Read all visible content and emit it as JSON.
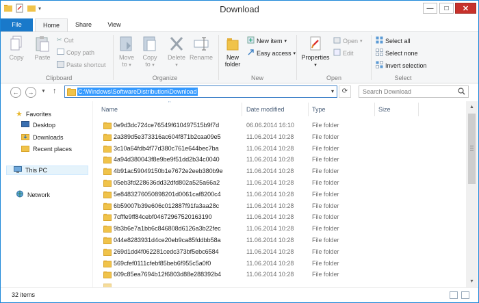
{
  "window": {
    "title": "Download"
  },
  "ribbon": {
    "tabs": {
      "file": "File",
      "home": "Home",
      "share": "Share",
      "view": "View"
    },
    "clipboard": {
      "copy": "Copy",
      "paste": "Paste",
      "cut": "Cut",
      "copy_path": "Copy path",
      "paste_shortcut": "Paste shortcut",
      "label": "Clipboard"
    },
    "organize": {
      "move_to_1": "Move",
      "move_to_2": "to",
      "copy_to_1": "Copy",
      "copy_to_2": "to",
      "delete": "Delete",
      "rename": "Rename",
      "label": "Organize"
    },
    "new": {
      "new_folder_1": "New",
      "new_folder_2": "folder",
      "new_item": "New item",
      "easy_access": "Easy access",
      "label": "New"
    },
    "open": {
      "properties": "Properties",
      "open": "Open",
      "edit": "Edit",
      "label": "Open"
    },
    "select": {
      "select_all": "Select all",
      "select_none": "Select none",
      "invert": "Invert selection",
      "label": "Select"
    }
  },
  "address": {
    "path": "C:\\Windows\\SoftwareDistribution\\Download",
    "search_placeholder": "Search Download"
  },
  "nav_pane": {
    "favorites": "Favorites",
    "desktop": "Desktop",
    "downloads": "Downloads",
    "recent": "Recent places",
    "this_pc": "This PC",
    "network": "Network"
  },
  "columns": {
    "name": "Name",
    "date": "Date modified",
    "type": "Type",
    "size": "Size"
  },
  "files": [
    {
      "name": "0e9d3dc724ce76549f610497515b9f7d",
      "date": "06.06.2014 16:10",
      "type": "File folder"
    },
    {
      "name": "2a389d5e373316ac604f871b2caa09e5",
      "date": "11.06.2014 10:28",
      "type": "File folder"
    },
    {
      "name": "3c10a64fdb4f77d380c761e644bec7ba",
      "date": "11.06.2014 10:28",
      "type": "File folder"
    },
    {
      "name": "4a94d380043f8e9be9f51dd2b34c0040",
      "date": "11.06.2014 10:28",
      "type": "File folder"
    },
    {
      "name": "4b91ac59049150b1e7672e2eeb380b9e",
      "date": "11.06.2014 10:28",
      "type": "File folder"
    },
    {
      "name": "05eb3fd228636dd32dfd802a525a66a2",
      "date": "11.06.2014 10:28",
      "type": "File folder"
    },
    {
      "name": "5e8483276050898201d0061caf8200c4",
      "date": "11.06.2014 10:28",
      "type": "File folder"
    },
    {
      "name": "6b59007b39e606c012887f91fa3aa28c",
      "date": "11.06.2014 10:28",
      "type": "File folder"
    },
    {
      "name": "7cfffe9ff84cebf04672967520163190",
      "date": "11.06.2014 10:28",
      "type": "File folder"
    },
    {
      "name": "9b3b6e7a1bb6c846808d6126a3b22fec",
      "date": "11.06.2014 10:28",
      "type": "File folder"
    },
    {
      "name": "044e8283931d4ce20eb9ca85fddbb58a",
      "date": "11.06.2014 10:28",
      "type": "File folder"
    },
    {
      "name": "269d1dd4f062281cedc373bf5ebc6584",
      "date": "11.06.2014 10:28",
      "type": "File folder"
    },
    {
      "name": "569cfef0111cfebf85beb6f955c5a0f0",
      "date": "11.06.2014 10:28",
      "type": "File folder"
    },
    {
      "name": "609c85ea7694b12f6803d88e288392b4",
      "date": "11.06.2014 10:28",
      "type": "File folder"
    }
  ],
  "status": {
    "count": "32 items"
  },
  "colors": {
    "accent": "#1979ca",
    "selection": "#3399ff",
    "folder": "#f0c34a",
    "close": "#c7312b"
  }
}
